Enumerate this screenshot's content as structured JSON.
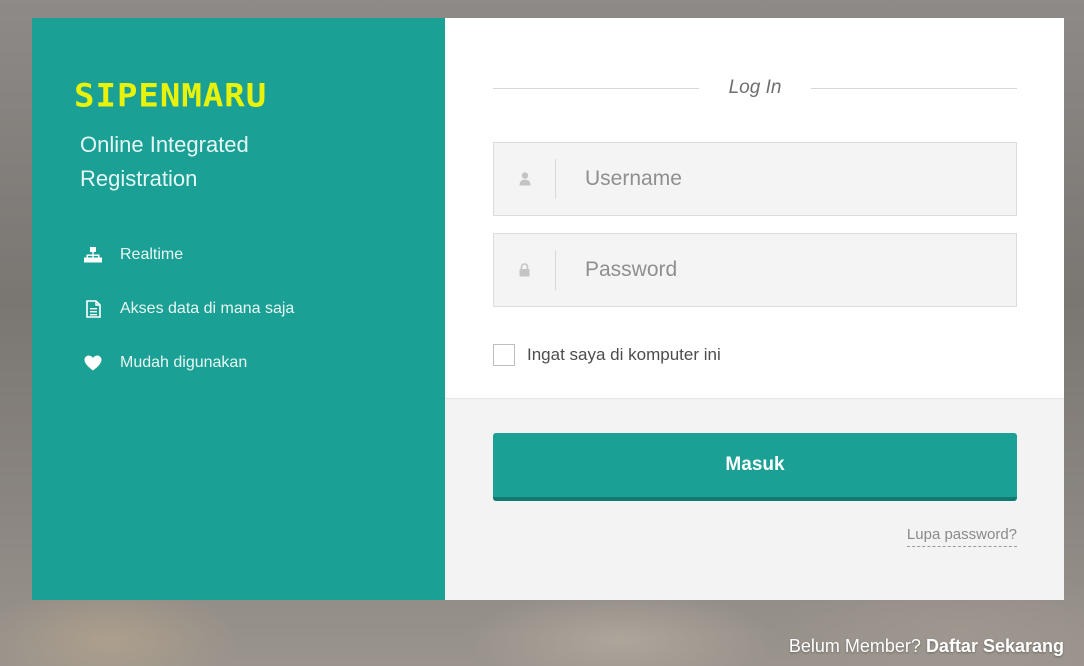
{
  "brand": {
    "logo": "SIPENMARU",
    "tagline": "Online Integrated Registration",
    "logo_color": "#e8f20a",
    "panel_color": "#1aa094"
  },
  "features": [
    {
      "icon": "sitemap-icon",
      "label": "Realtime"
    },
    {
      "icon": "file-icon",
      "label": "Akses data di mana saja"
    },
    {
      "icon": "heart-icon",
      "label": "Mudah digunakan"
    }
  ],
  "login": {
    "title": "Log In",
    "username_placeholder": "Username",
    "password_placeholder": "Password",
    "remember_label": "Ingat saya di komputer ini",
    "submit_label": "Masuk",
    "forgot_label": "Lupa password?"
  },
  "footer": {
    "prompt": "Belum Member?",
    "signup_label": "Daftar Sekarang"
  }
}
